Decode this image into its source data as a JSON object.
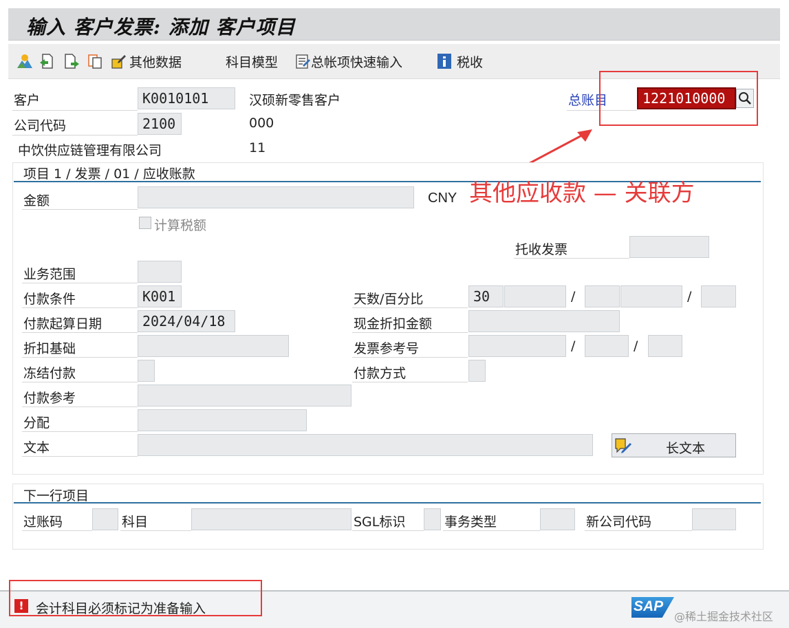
{
  "title": "输入 客户发票: 添加 客户项目",
  "toolbar": {
    "other_data": "其他数据",
    "account_model": "科目模型",
    "gl_fast_entry": "总帐项快速输入",
    "tax": "税收"
  },
  "header": {
    "customer_label": "客户",
    "customer_value": "K0010101",
    "customer_name": "汉硕新零售客户",
    "company_code_label": "公司代码",
    "company_code_value": "2100",
    "company_code_extra": "000",
    "company_name": "中饮供应链管理有限公司",
    "company_extra": "11",
    "gl_account_label": "总账目",
    "gl_account_value": "1221010000"
  },
  "item_group": {
    "title": "项目 1 / 发票 / 01 / 应收账款",
    "amount_label": "金额",
    "amount_value": "",
    "currency": "CNY",
    "calc_tax_label": "计算税额",
    "calc_tax_checked": false,
    "collection_invoice_label": "托收发票",
    "business_area_label": "业务范围",
    "payment_terms_label": "付款条件",
    "payment_terms_value": "K001",
    "days_percent_label": "天数/百分比",
    "days1": "30",
    "separator": "/",
    "baseline_date_label": "付款起算日期",
    "baseline_date_value": "2024/04/18",
    "cash_discount_amount_label": "现金折扣金额",
    "discount_base_label": "折扣基础",
    "invoice_ref_label": "发票参考号",
    "payment_block_label": "冻结付款",
    "payment_method_label": "付款方式",
    "payment_ref_label": "付款参考",
    "assignment_label": "分配",
    "text_label": "文本",
    "long_text_button": "长文本"
  },
  "next_item": {
    "title": "下一行项目",
    "posting_key_label": "过账码",
    "account_label": "科目",
    "sgl_label": "SGL标识",
    "transaction_type_label": "事务类型",
    "new_company_code_label": "新公司代码"
  },
  "annotation": {
    "text": "其他应收款 — 关联方",
    "color": "#e63b3b"
  },
  "status": {
    "message": "会计科目必须标记为准备输入",
    "logo": "SAP",
    "watermark": "@稀土掘金技术社区"
  }
}
